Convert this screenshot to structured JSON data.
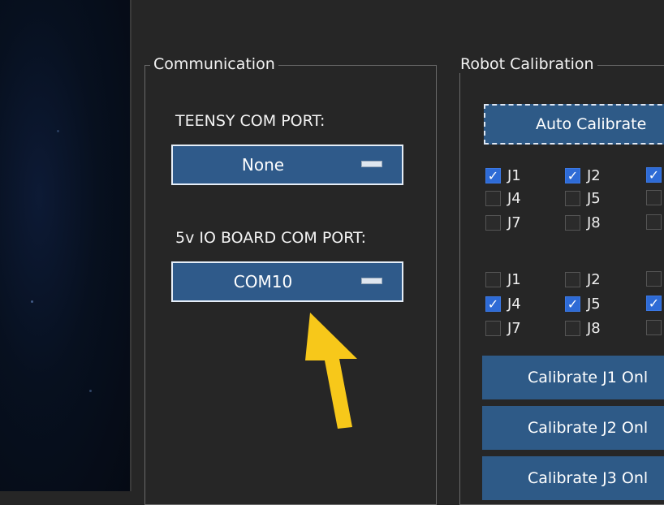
{
  "communication": {
    "title": "Communication",
    "teensy_label": "TEENSY COM PORT:",
    "teensy_value": "None",
    "io_label": "5v IO BOARD COM PORT:",
    "io_value": "COM10"
  },
  "calibration": {
    "title": "Robot Calibration",
    "auto_button": "Auto Calibrate",
    "group1": [
      {
        "label": "J1",
        "checked": true
      },
      {
        "label": "J2",
        "checked": true
      },
      {
        "label": "",
        "checked": true
      },
      {
        "label": "J4",
        "checked": false
      },
      {
        "label": "J5",
        "checked": false
      },
      {
        "label": "",
        "checked": false
      },
      {
        "label": "J7",
        "checked": false
      },
      {
        "label": "J8",
        "checked": false
      },
      {
        "label": "",
        "checked": false
      }
    ],
    "group2": [
      {
        "label": "J1",
        "checked": false
      },
      {
        "label": "J2",
        "checked": false
      },
      {
        "label": "",
        "checked": false
      },
      {
        "label": "J4",
        "checked": true
      },
      {
        "label": "J5",
        "checked": true
      },
      {
        "label": "",
        "checked": true
      },
      {
        "label": "J7",
        "checked": false
      },
      {
        "label": "J8",
        "checked": false
      },
      {
        "label": "",
        "checked": false
      }
    ],
    "buttons": [
      "Calibrate J1 Onl",
      "Calibrate J2 Onl",
      "Calibrate J3 Onl"
    ]
  },
  "colors": {
    "button_blue": "#2e5a87",
    "check_blue": "#2e6bd6",
    "arrow_yellow": "#f7c81a"
  }
}
